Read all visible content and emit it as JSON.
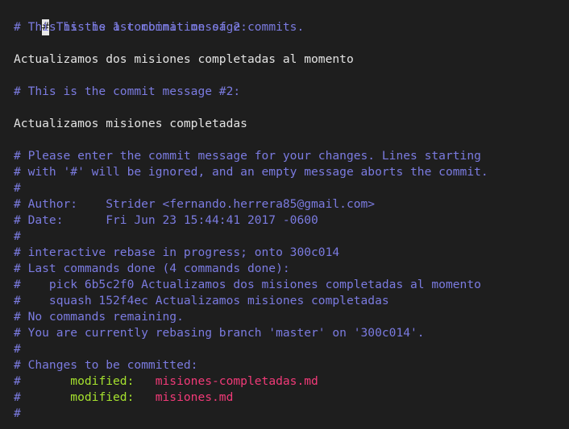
{
  "editor": {
    "cursor_char": "#",
    "lines": [
      {
        "type": "cursor-comment",
        "rest": " This is a combination of 2 commits."
      },
      {
        "type": "comment",
        "text": "# This is the 1st commit message:"
      },
      {
        "type": "blank",
        "text": ""
      },
      {
        "type": "plain",
        "text": "Actualizamos dos misiones completadas al momento"
      },
      {
        "type": "blank",
        "text": ""
      },
      {
        "type": "comment",
        "text": "# This is the commit message #2:"
      },
      {
        "type": "blank",
        "text": ""
      },
      {
        "type": "plain",
        "text": "Actualizamos misiones completadas"
      },
      {
        "type": "blank",
        "text": ""
      },
      {
        "type": "comment",
        "text": "# Please enter the commit message for your changes. Lines starting"
      },
      {
        "type": "comment",
        "text": "# with '#' will be ignored, and an empty message aborts the commit."
      },
      {
        "type": "comment",
        "text": "#"
      },
      {
        "type": "comment",
        "text": "# Author:    Strider <fernando.herrera85@gmail.com>"
      },
      {
        "type": "comment",
        "text": "# Date:      Fri Jun 23 15:44:41 2017 -0600"
      },
      {
        "type": "comment",
        "text": "#"
      },
      {
        "type": "comment",
        "text": "# interactive rebase in progress; onto 300c014"
      },
      {
        "type": "comment",
        "text": "# Last commands done (4 commands done):"
      },
      {
        "type": "comment",
        "text": "#    pick 6b5c2f0 Actualizamos dos misiones completadas al momento"
      },
      {
        "type": "comment",
        "text": "#    squash 152f4ec Actualizamos misiones completadas"
      },
      {
        "type": "comment",
        "text": "# No commands remaining."
      },
      {
        "type": "comment",
        "text": "# You are currently rebasing branch 'master' on '300c014'."
      },
      {
        "type": "comment",
        "text": "#"
      },
      {
        "type": "comment",
        "text": "# Changes to be committed:"
      },
      {
        "type": "change",
        "prefix": "#\t",
        "status": "modified:",
        "file": "misiones-completadas.md"
      },
      {
        "type": "change",
        "prefix": "#\t",
        "status": "modified:",
        "file": "misiones.md"
      },
      {
        "type": "comment",
        "text": "#"
      }
    ]
  },
  "colors": {
    "background": "#1e1e1e",
    "comment": "#7b7be0",
    "plain_text": "#e4e4e4",
    "modified_keyword": "#a6e22e",
    "file_name": "#f23a78"
  }
}
